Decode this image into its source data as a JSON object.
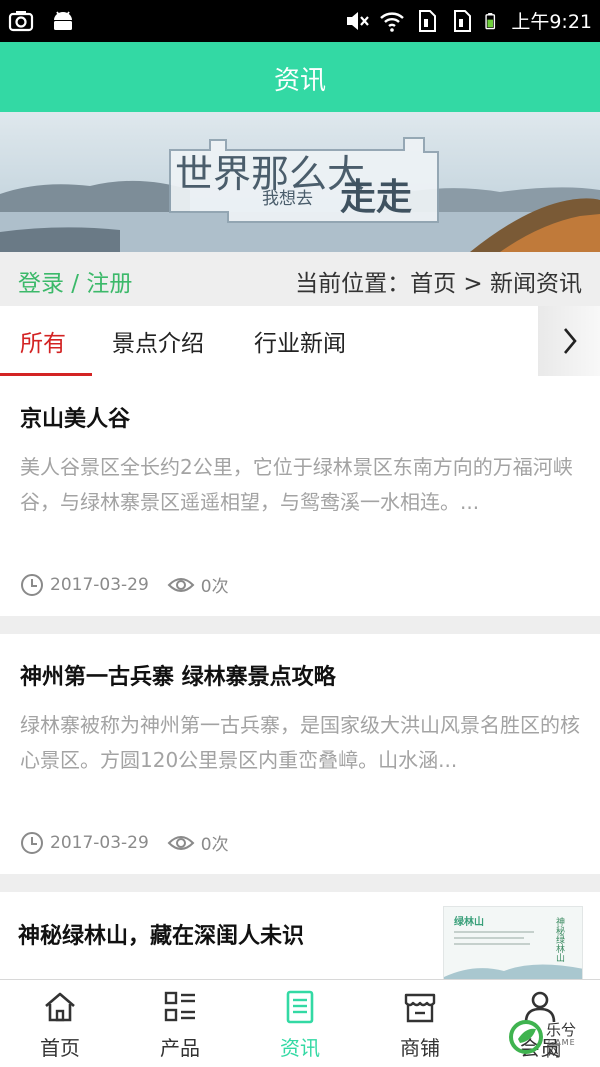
{
  "status_bar": {
    "time": "上午9:21",
    "icons": [
      "camera-icon",
      "android-icon",
      "mute-icon",
      "wifi-icon",
      "sim-icon",
      "sim-icon",
      "battery-icon"
    ]
  },
  "header": {
    "title": "资讯"
  },
  "banner": {
    "line1": "世界那么大",
    "line2": "我想去",
    "line3": "走走",
    "colors": {
      "sky": "#c9dbe4",
      "water": "#aebfcb",
      "mountain": "#60707c"
    }
  },
  "location_bar": {
    "login_label": "登录 / 注册",
    "location_text": "当前位置：首页 > 新闻资讯"
  },
  "tabs": {
    "items": [
      {
        "label": "所有",
        "active": true
      },
      {
        "label": "景点介绍",
        "active": false
      },
      {
        "label": "行业新闻",
        "active": false
      }
    ],
    "more_icon": "chevron-right-icon"
  },
  "news": [
    {
      "title": "京山美人谷",
      "summary": "美人谷景区全长约2公里，它位于绿林景区东南方向的万福河峡谷，与绿林寨景区遥遥相望，与鸳鸯溪一水相连。...",
      "date": "2017-03-29",
      "views": "0次"
    },
    {
      "title": "神州第一古兵寨 绿林寨景点攻略",
      "summary": "绿林寨被称为神州第一古兵寨，是国家级大洪山风景名胜区的核心景区。方圆120公里景区内重峦叠嶂。山水涵...",
      "date": "2017-03-29",
      "views": "0次"
    },
    {
      "title": "神秘绿林山，藏在深闺人未识",
      "thumbnail_text": "绿林山",
      "thumbnail_side_text": "神秘绿林山"
    }
  ],
  "bottom_nav": {
    "items": [
      {
        "label": "首页",
        "icon": "home-icon",
        "active": false
      },
      {
        "label": "产品",
        "icon": "grid-list-icon",
        "active": false
      },
      {
        "label": "资讯",
        "icon": "document-icon",
        "active": true
      },
      {
        "label": "商铺",
        "icon": "store-icon",
        "active": false
      },
      {
        "label": "会员",
        "icon": "user-icon",
        "active": false
      }
    ],
    "active_color": "#33d9a4"
  },
  "watermark": {
    "text": "乐兮网",
    "sub": "GAME"
  }
}
